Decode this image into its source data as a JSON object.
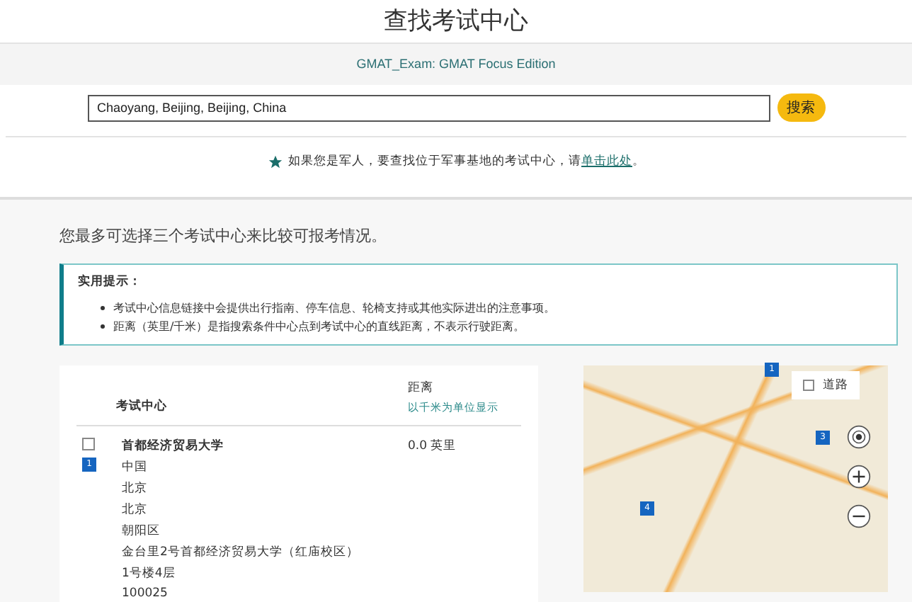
{
  "page_title": "查找考试中心",
  "exam": "GMAT_Exam: GMAT Focus Edition",
  "search": {
    "value": "Chaoyang, Beijing, Beijing, China",
    "button": "搜索"
  },
  "military_note": {
    "text": "如果您是军人，要查找位于军事基地的考试中心，请",
    "link": "单击此处",
    "end": "。"
  },
  "intro": "您最多可选择三个考试中心来比较可报考情况。",
  "tips": {
    "title": "实用提示：",
    "items": [
      "考试中心信息链接中会提供出行指南、停车信息、轮椅支持或其他实际进出的注意事项。",
      "距离（英里/千米）是指搜索条件中心点到考试中心的直线距离，不表示行驶距离。"
    ]
  },
  "table": {
    "columns": [
      {
        "label": "考试中心"
      },
      {
        "label": "距离",
        "sub": "以千米为单位显示"
      }
    ],
    "rows": [
      {
        "checked": false,
        "pin": "1",
        "name": "首都经济贸易大学",
        "address": [
          "中国",
          "北京",
          "北京",
          "朝阳区",
          "金台里2号首都经济贸易大学（红庙校区）",
          "1号楼4层",
          "100025"
        ],
        "distance": "0.0 英里"
      }
    ]
  },
  "map": {
    "layer_toggle": {
      "label": "道路",
      "checked": false
    },
    "pins": [
      {
        "label": "1"
      },
      {
        "label": "3"
      },
      {
        "label": "4"
      }
    ]
  }
}
